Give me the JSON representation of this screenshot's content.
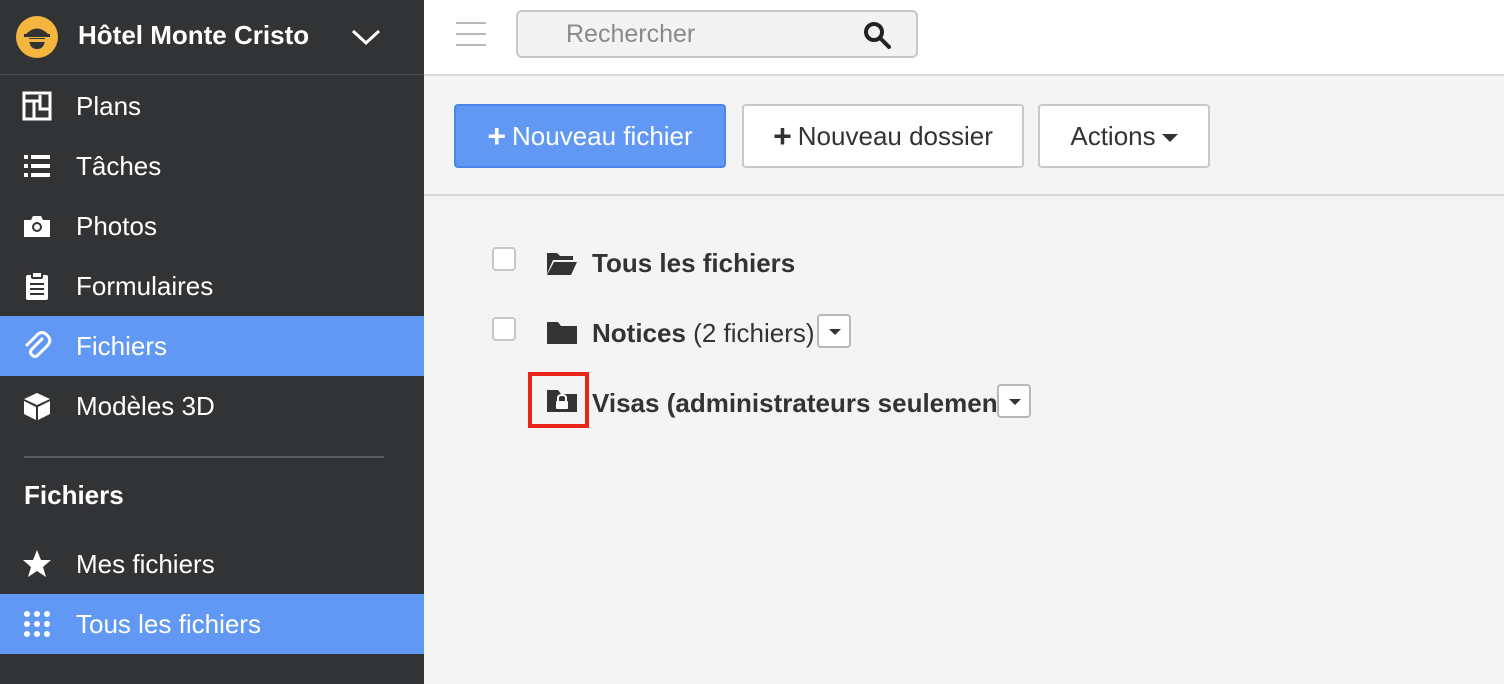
{
  "sidebar": {
    "project_name": "Hôtel Monte Cristo",
    "items": [
      {
        "label": "Plans",
        "icon": "plans-icon"
      },
      {
        "label": "Tâches",
        "icon": "list-icon"
      },
      {
        "label": "Photos",
        "icon": "camera-icon"
      },
      {
        "label": "Formulaires",
        "icon": "clipboard-icon"
      },
      {
        "label": "Fichiers",
        "icon": "paperclip-icon",
        "active": true
      },
      {
        "label": "Modèles 3D",
        "icon": "cube-icon"
      }
    ],
    "section_title": "Fichiers",
    "section_items": [
      {
        "label": "Mes fichiers",
        "icon": "star-icon"
      },
      {
        "label": "Tous les fichiers",
        "icon": "grid-dots-icon",
        "active": true
      }
    ]
  },
  "topbar": {
    "search_placeholder": "Rechercher"
  },
  "toolbar": {
    "new_file_label": "Nouveau fichier",
    "new_folder_label": "Nouveau dossier",
    "actions_label": "Actions"
  },
  "files": {
    "rows": [
      {
        "name": "Tous les fichiers",
        "count": ""
      },
      {
        "name": "Notices",
        "count": "(2 fichiers)"
      },
      {
        "name": "Visas (administrateurs seulement)",
        "count": ""
      }
    ]
  },
  "colors": {
    "sidebar_bg": "#323335",
    "accent": "#6198f4",
    "highlight": "#e8261a"
  }
}
